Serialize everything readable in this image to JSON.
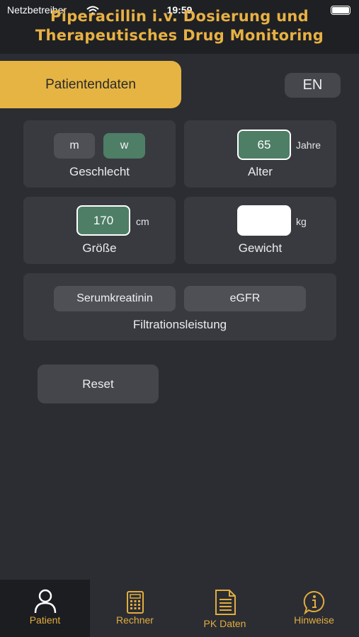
{
  "status_bar": {
    "carrier": "Netzbetreiber",
    "time": "19:59"
  },
  "header": {
    "title_line1": "Piperacillin i.v. Dosierung und",
    "title_line2": "Therapeutisches Drug Monitoring"
  },
  "top": {
    "section_tab": "Patientendaten",
    "language_button": "EN"
  },
  "sex": {
    "option_m": "m",
    "option_w": "w",
    "selected": "w",
    "label": "Geschlecht"
  },
  "age": {
    "value": "65",
    "unit": "Jahre",
    "label": "Alter"
  },
  "height": {
    "value": "170",
    "unit": "cm",
    "label": "Größe"
  },
  "weight": {
    "value": "",
    "unit": "kg",
    "label": "Gewicht"
  },
  "filtration": {
    "option_1": "Serumkreatinin",
    "option_2": "eGFR",
    "label": "Filtrationsleistung"
  },
  "actions": {
    "reset": "Reset"
  },
  "tabbar": {
    "items": [
      {
        "label": "Patient",
        "icon": "person-icon",
        "active": true
      },
      {
        "label": "Rechner",
        "icon": "calculator-icon",
        "active": false
      },
      {
        "label": "PK Daten",
        "icon": "document-icon",
        "active": false
      },
      {
        "label": "Hinweise",
        "icon": "info-icon",
        "active": false
      }
    ]
  },
  "colors": {
    "accent": "#e6b443",
    "selected_green": "#4e7e66",
    "background": "#2b2d33",
    "card": "#383a40"
  }
}
